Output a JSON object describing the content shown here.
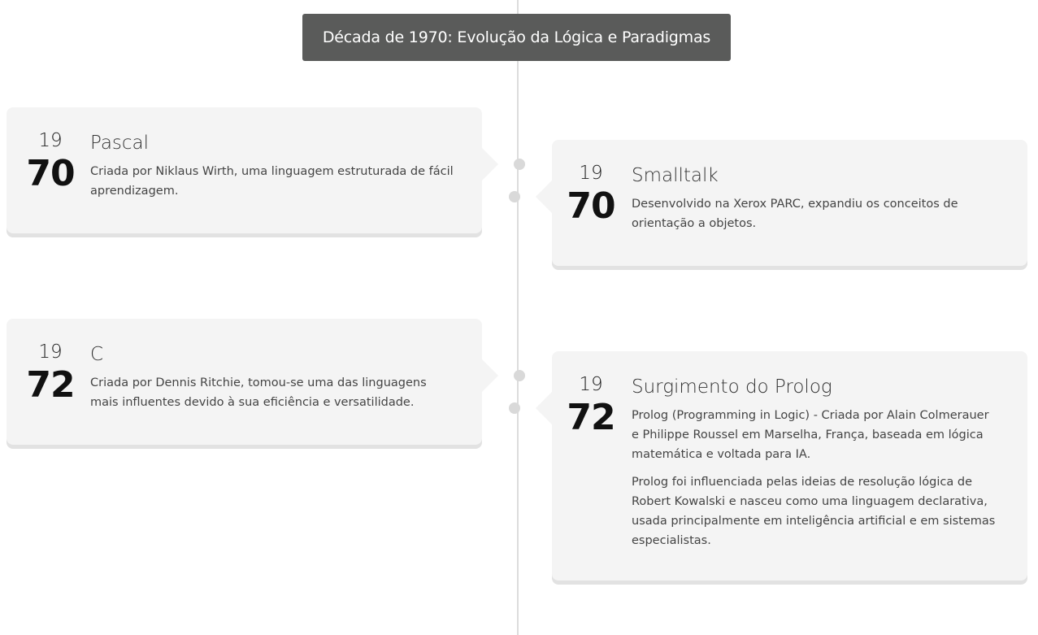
{
  "decade_title": "Década de 1970: Evolução da Lógica e Paradigmas",
  "events": [
    {
      "century": "19",
      "decade": "70",
      "title": "Pascal",
      "description": [
        "Criada por Niklaus Wirth, uma linguagem estruturada de fácil aprendizagem."
      ]
    },
    {
      "century": "19",
      "decade": "70",
      "title": "Smalltalk",
      "description": [
        "Desenvolvido na Xerox PARC, expandiu os conceitos de orientação a objetos."
      ]
    },
    {
      "century": "19",
      "decade": "72",
      "title": "C",
      "description": [
        "Criada por Dennis Ritchie, tomou-se uma das linguagens mais influentes devido à sua eficiência e versatilidade."
      ]
    },
    {
      "century": "19",
      "decade": "72",
      "title": "Surgimento do Prolog",
      "description": [
        "Prolog (Programming in Logic) - Criada por Alain Colmerauer e Philippe Roussel em Marselha, França, baseada em lógica matemática e voltada para IA.",
        "Prolog foi influenciada pelas ideias de resolução lógica de Robert Kowalski e nasceu como uma linguagem declarativa, usada principalmente em inteligência artificial e em sistemas especialistas."
      ]
    }
  ]
}
